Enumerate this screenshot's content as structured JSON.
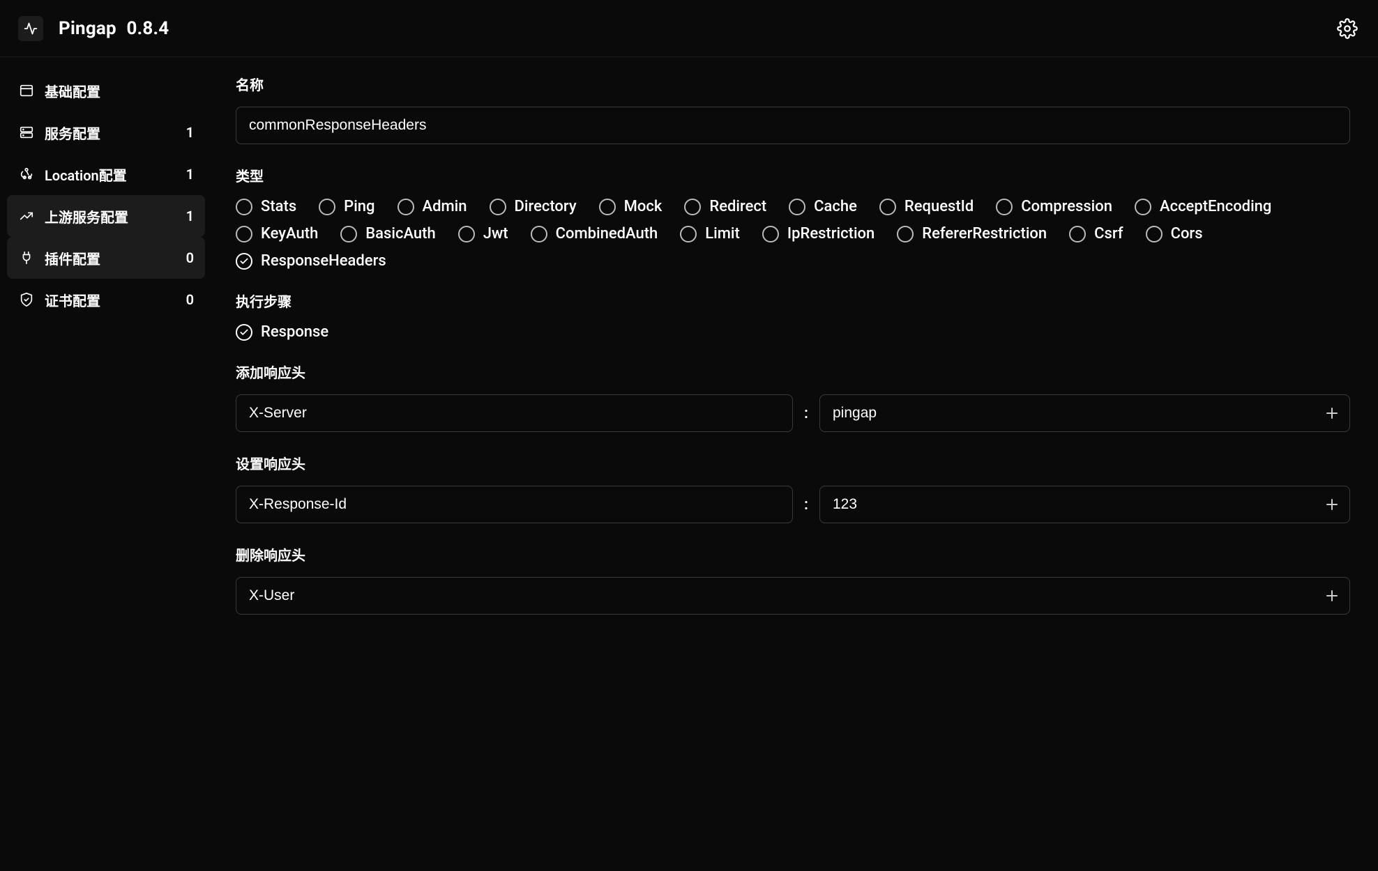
{
  "header": {
    "app_name": "Pingap",
    "version": "0.8.4"
  },
  "sidebar": {
    "items": [
      {
        "id": "basic",
        "label": "基础配置",
        "count": null,
        "active": false,
        "icon": "window"
      },
      {
        "id": "service",
        "label": "服务配置",
        "count": "1",
        "active": false,
        "icon": "server"
      },
      {
        "id": "location",
        "label": "Location配置",
        "count": "1",
        "active": false,
        "icon": "webhook"
      },
      {
        "id": "upstream",
        "label": "上游服务配置",
        "count": "1",
        "active": true,
        "icon": "trend"
      },
      {
        "id": "plugin",
        "label": "插件配置",
        "count": "0",
        "active": true,
        "icon": "plug"
      },
      {
        "id": "cert",
        "label": "证书配置",
        "count": "0",
        "active": false,
        "icon": "shield"
      }
    ]
  },
  "form": {
    "name_label": "名称",
    "name_value": "commonResponseHeaders",
    "type_label": "类型",
    "types": [
      {
        "label": "Stats",
        "checked": false
      },
      {
        "label": "Ping",
        "checked": false
      },
      {
        "label": "Admin",
        "checked": false
      },
      {
        "label": "Directory",
        "checked": false
      },
      {
        "label": "Mock",
        "checked": false
      },
      {
        "label": "Redirect",
        "checked": false
      },
      {
        "label": "Cache",
        "checked": false
      },
      {
        "label": "RequestId",
        "checked": false
      },
      {
        "label": "Compression",
        "checked": false
      },
      {
        "label": "AcceptEncoding",
        "checked": false
      },
      {
        "label": "KeyAuth",
        "checked": false
      },
      {
        "label": "BasicAuth",
        "checked": false
      },
      {
        "label": "Jwt",
        "checked": false
      },
      {
        "label": "CombinedAuth",
        "checked": false
      },
      {
        "label": "Limit",
        "checked": false
      },
      {
        "label": "IpRestriction",
        "checked": false
      },
      {
        "label": "RefererRestriction",
        "checked": false
      },
      {
        "label": "Csrf",
        "checked": false
      },
      {
        "label": "Cors",
        "checked": false
      },
      {
        "label": "ResponseHeaders",
        "checked": true
      }
    ],
    "step_label": "执行步骤",
    "steps": [
      {
        "label": "Response",
        "checked": true
      }
    ],
    "add_headers_label": "添加响应头",
    "add_headers": {
      "key": "X-Server",
      "value": "pingap"
    },
    "set_headers_label": "设置响应头",
    "set_headers": {
      "key": "X-Response-Id",
      "value": "123"
    },
    "del_headers_label": "删除响应头",
    "del_headers": {
      "value": "X-User"
    }
  }
}
